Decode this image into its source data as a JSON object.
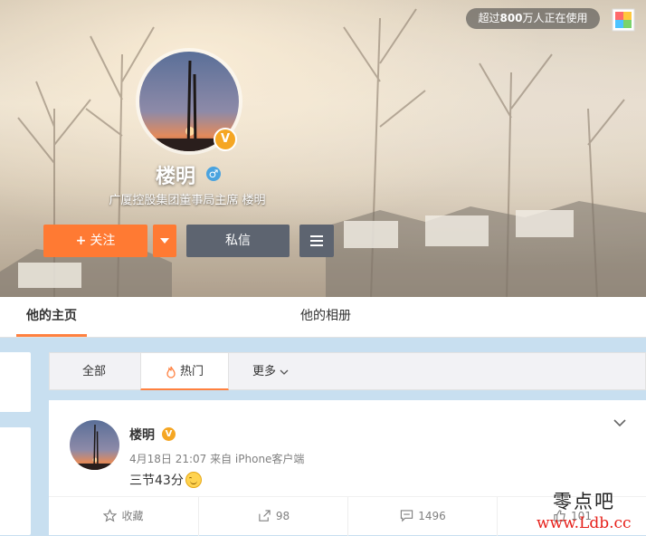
{
  "header": {
    "users_prefix": "超过",
    "users_count": "800",
    "users_suffix": "万人正在使用"
  },
  "profile": {
    "name": "楼明",
    "verified_badge": "V",
    "gender_symbol": "♂",
    "bio": "广厦控股集团董事局主席 楼明",
    "follow_plus": "+",
    "follow_label": "关注",
    "message_label": "私信"
  },
  "tabs": [
    {
      "label": "他的主页",
      "active": true
    },
    {
      "label": "他的相册",
      "active": false
    }
  ],
  "filter_tabs": {
    "all": "全部",
    "hot": "热门",
    "more": "更多"
  },
  "post": {
    "author": "楼明",
    "verified_badge": "V",
    "meta": "4月18日 21:07 来自 iPhone客户端",
    "text": "三节43分",
    "actions": {
      "favorite": "收藏",
      "repost": "98",
      "comment": "1496",
      "like": "101"
    }
  },
  "watermark": {
    "line1": "零点吧",
    "line2": "www.Ldb.cc"
  },
  "colors": {
    "accent": "#ff7a33",
    "dark_button": "#5d6470",
    "verified": "#f5a623",
    "link_blue": "#4aa3df"
  },
  "icons": [
    "skin-icon",
    "verified-icon",
    "male-icon",
    "dropdown-icon",
    "menu-icon",
    "flame-icon",
    "chevron-down-icon",
    "star-icon",
    "repost-icon",
    "comment-icon",
    "like-icon"
  ]
}
